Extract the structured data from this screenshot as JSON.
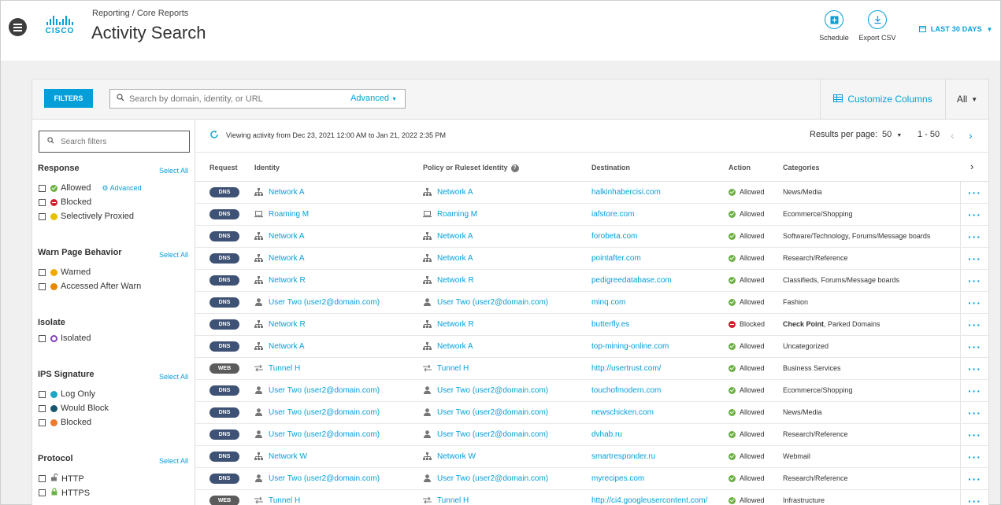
{
  "header": {
    "breadcrumb": "Reporting / Core Reports",
    "title": "Activity Search",
    "logo_text": "CISCO",
    "schedule_label": "Schedule",
    "export_label": "Export CSV",
    "range_label": "LAST 30 DAYS"
  },
  "toolbar": {
    "filters_label": "FILTERS",
    "search_placeholder": "Search by domain, identity, or URL",
    "advanced_label": "Advanced",
    "customize_label": "Customize Columns",
    "all_label": "All"
  },
  "sidebar": {
    "search_placeholder": "Search filters",
    "select_all": "Select All",
    "response": {
      "title": "Response",
      "options": [
        "Allowed",
        "Blocked",
        "Selectively Proxied"
      ],
      "advanced": "Advanced"
    },
    "warn": {
      "title": "Warn Page Behavior",
      "options": [
        "Warned",
        "Accessed After Warn"
      ]
    },
    "isolate": {
      "title": "Isolate",
      "options": [
        "Isolated"
      ]
    },
    "ips": {
      "title": "IPS Signature",
      "options": [
        "Log Only",
        "Would Block",
        "Blocked"
      ]
    },
    "protocol": {
      "title": "Protocol",
      "options": [
        "HTTP",
        "HTTPS"
      ]
    }
  },
  "main": {
    "viewing": "Viewing activity from Dec 23, 2021 12:00 AM to Jan 21, 2022 2:35 PM",
    "rpp_label": "Results per page:",
    "rpp_value": "50",
    "range": "1 - 50"
  },
  "table": {
    "headers": [
      "Request",
      "Identity",
      "Policy or Ruleset Identity",
      "Destination",
      "Action",
      "Categories"
    ],
    "rows": [
      {
        "req": "DNS",
        "icon": "network",
        "identity": "Network A",
        "policy": "Network A",
        "dest": "halkinhabercisi.com",
        "action": "Allowed",
        "cat": "News/Media",
        "cat_bold": ""
      },
      {
        "req": "DNS",
        "icon": "laptop",
        "identity": "Roaming M",
        "policy": "Roaming M",
        "dest": "iafstore.com",
        "action": "Allowed",
        "cat": "Ecommerce/Shopping",
        "cat_bold": ""
      },
      {
        "req": "DNS",
        "icon": "network",
        "identity": "Network A",
        "policy": "Network A",
        "dest": "forobeta.com",
        "action": "Allowed",
        "cat": "Software/Technology, Forums/Message boards",
        "cat_bold": ""
      },
      {
        "req": "DNS",
        "icon": "network",
        "identity": "Network A",
        "policy": "Network A",
        "dest": "pointafter.com",
        "action": "Allowed",
        "cat": "Research/Reference",
        "cat_bold": ""
      },
      {
        "req": "DNS",
        "icon": "network",
        "identity": "Network R",
        "policy": "Network R",
        "dest": "pedigreedatabase.com",
        "action": "Allowed",
        "cat": "Classifieds, Forums/Message boards",
        "cat_bold": ""
      },
      {
        "req": "DNS",
        "icon": "user",
        "identity": "User Two (user2@domain.com)",
        "policy": "User Two (user2@domain.com)",
        "dest": "minq.com",
        "action": "Allowed",
        "cat": "Fashion",
        "cat_bold": ""
      },
      {
        "req": "DNS",
        "icon": "network",
        "identity": "Network R",
        "policy": "Network R",
        "dest": "butterfly.es",
        "action": "Blocked",
        "cat": ", Parked Domains",
        "cat_bold": "Check Point"
      },
      {
        "req": "DNS",
        "icon": "network",
        "identity": "Network A",
        "policy": "Network A",
        "dest": "top-mining-online.com",
        "action": "Allowed",
        "cat": "Uncategorized",
        "cat_bold": ""
      },
      {
        "req": "WEB",
        "icon": "tunnel",
        "identity": "Tunnel H",
        "policy": "Tunnel H",
        "dest": "http://usertrust.com/",
        "action": "Allowed",
        "cat": "Business Services",
        "cat_bold": ""
      },
      {
        "req": "DNS",
        "icon": "user",
        "identity": "User Two (user2@domain.com)",
        "policy": "User Two (user2@domain.com)",
        "dest": "touchofmodern.com",
        "action": "Allowed",
        "cat": "Ecommerce/Shopping",
        "cat_bold": ""
      },
      {
        "req": "DNS",
        "icon": "user",
        "identity": "User Two (user2@domain.com)",
        "policy": "User Two (user2@domain.com)",
        "dest": "newschicken.com",
        "action": "Allowed",
        "cat": "News/Media",
        "cat_bold": ""
      },
      {
        "req": "DNS",
        "icon": "user",
        "identity": "User Two (user2@domain.com)",
        "policy": "User Two (user2@domain.com)",
        "dest": "dvhab.ru",
        "action": "Allowed",
        "cat": "Research/Reference",
        "cat_bold": ""
      },
      {
        "req": "DNS",
        "icon": "network",
        "identity": "Network W",
        "policy": "Network W",
        "dest": "smartresponder.ru",
        "action": "Allowed",
        "cat": "Webmail",
        "cat_bold": ""
      },
      {
        "req": "DNS",
        "icon": "user",
        "identity": "User Two (user2@domain.com)",
        "policy": "User Two (user2@domain.com)",
        "dest": "myrecipes.com",
        "action": "Allowed",
        "cat": "Research/Reference",
        "cat_bold": ""
      },
      {
        "req": "WEB",
        "icon": "tunnel",
        "identity": "Tunnel H",
        "policy": "Tunnel H",
        "dest": "http://ci4.googleusercontent.com/",
        "action": "Allowed",
        "cat": "Infrastructure",
        "cat_bold": ""
      }
    ]
  }
}
